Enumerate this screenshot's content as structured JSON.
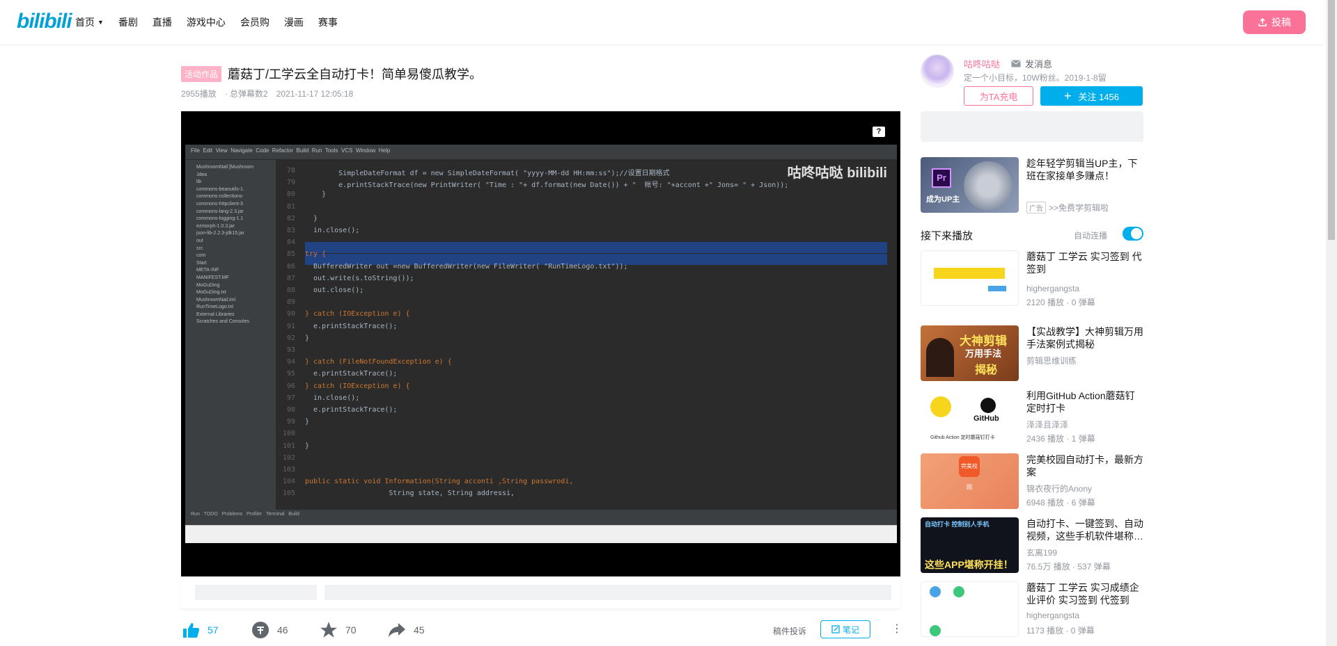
{
  "nav": {
    "logo": "bilibili",
    "items": [
      "首页",
      "番剧",
      "直播",
      "游戏中心",
      "会员购",
      "漫画",
      "赛事"
    ],
    "upload_label": "投稿"
  },
  "video": {
    "tag": "活动作品",
    "title": "蘑菇丁/工学云全自动打卡！简单易傻瓜教学。",
    "views": "2955播放",
    "danmaku": "· 总弹幕数2",
    "date": "2021-11-17 12:05:18"
  },
  "player": {
    "watermark": "咕咚咕哒 bilibili",
    "help": "?",
    "code_lines": [
      {
        "n": "78",
        "t": "        SimpleDateFormat df = new SimpleDateFormat( \"yyyy-MM-dd HH:mm:ss\");//设置日期格式"
      },
      {
        "n": "79",
        "t": "        e.printStackTrace(new PrintWriter( \"Time : \"+ df.format(new Date()) + \"  帐号: \"+accont +\" Jons= \" + Json));"
      },
      {
        "n": "80",
        "t": "    }"
      },
      {
        "n": "81",
        "t": ""
      },
      {
        "n": "82",
        "t": "  }"
      },
      {
        "n": "83",
        "t": "  in.close();"
      },
      {
        "n": "84",
        "t": ""
      },
      {
        "n": "85",
        "t": "try {"
      },
      {
        "n": "86",
        "t": "  BufferedWriter out =new BufferedWriter(new FileWriter( \"RunTimeLogo.txt\"));"
      },
      {
        "n": "87",
        "t": "  out.write(s.toString());"
      },
      {
        "n": "88",
        "t": "  out.close();"
      },
      {
        "n": "89",
        "t": ""
      },
      {
        "n": "90",
        "t": "} catch (IOException e) {"
      },
      {
        "n": "91",
        "t": "  e.printStackTrace();"
      },
      {
        "n": "92",
        "t": "}"
      },
      {
        "n": "93",
        "t": ""
      },
      {
        "n": "94",
        "t": "} catch (FileNotFoundException e) {"
      },
      {
        "n": "95",
        "t": "  e.printStackTrace();"
      },
      {
        "n": "96",
        "t": "} catch (IOException e) {"
      },
      {
        "n": "97",
        "t": "  in.close();"
      },
      {
        "n": "98",
        "t": "  e.printStackTrace();"
      },
      {
        "n": "99",
        "t": "}"
      },
      {
        "n": "100",
        "t": ""
      },
      {
        "n": "101",
        "t": "}"
      },
      {
        "n": "102",
        "t": ""
      },
      {
        "n": "103",
        "t": ""
      },
      {
        "n": "104",
        "t": "public static void Information(String acconti ,String passwrodi,"
      },
      {
        "n": "105",
        "t": "                    String state, String addressi,"
      }
    ],
    "project_tree": [
      "MushroomNail [Mushroom",
      "Jdea",
      "lib",
      "commons-beanutils-1.",
      "commons-collections-",
      "commons-httpclient-3",
      "commons-lang-2.3.jar",
      "commons-logging-1.1",
      "ezmorph-1.0.3.jar",
      "json-lib-2.2.3-jdk15.jar",
      "out",
      "src",
      "com",
      "Start",
      "META-INF",
      "MANIFEST.MF",
      "MoGuDing",
      "MoGuDing.txt",
      "MushroomNail.iml",
      "RunTimeLogo.txt",
      "External Libraries",
      "Scratches and Consoles"
    ]
  },
  "actions": {
    "like": "57",
    "coin": "46",
    "favorite": "70",
    "share": "45",
    "report": "稿件投诉",
    "note": "笔记"
  },
  "uploader": {
    "name": "咕咚咕哒",
    "message": "发消息",
    "desc": "定一个小目标，10W粉丝。2019-1-8留",
    "charge": "为TA充电",
    "follow": "关注 1456"
  },
  "ad": {
    "title": "趁年轻学剪辑当UP主，下班在家接单多赚点！",
    "tag": "广告",
    "link": ">>免费学剪辑啦"
  },
  "next": {
    "title": "接下来播放",
    "autoplay": "自动连播"
  },
  "recommendations": [
    {
      "title": "蘑菇丁 工学云 实习签到 代签到",
      "owner": "highergangsta",
      "stats": "2120 播放 · 0 弹幕"
    },
    {
      "title": "【实战教学】大神剪辑万用手法案例式揭秘",
      "owner": "剪辑思维训练",
      "stats": ""
    },
    {
      "title": "利用GitHub Action蘑菇钉定时打卡",
      "owner": "泽泽且泽泽",
      "stats": "2436 播放 · 1 弹幕"
    },
    {
      "title": "完美校园自动打卡，最新方案",
      "owner": "锦衣夜行的Anony",
      "stats": "6948 播放 · 6 弹幕"
    },
    {
      "title": "自动打卡、一键签到、自动视频，这些手机软件堪称…",
      "owner": "玄离199",
      "stats": "76.5万 播放 · 537 弹幕"
    },
    {
      "title": "蘑菇丁 工学云 实习成绩企业评价 实习签到 代签到",
      "owner": "highergangsta",
      "stats": "1173 播放 · 0 弹幕"
    }
  ],
  "thumb_texts": {
    "ad_badge": "Pr",
    "ad_caption": "成为UP主",
    "rec2_a": "大神剪辑",
    "rec2_b": "万用手法",
    "rec2_c": "揭秘",
    "rec3_brand": "GitHub",
    "rec3_caption": "Github Action 定时蘑菇钉打卡",
    "rec4_logo": "完美校园",
    "rec5_top": "自动打卡  控制别人手机",
    "rec5_bottom": "这些APP堪称开挂！"
  },
  "colors": {
    "accent": "#00aeec",
    "pink": "#fb7299"
  }
}
